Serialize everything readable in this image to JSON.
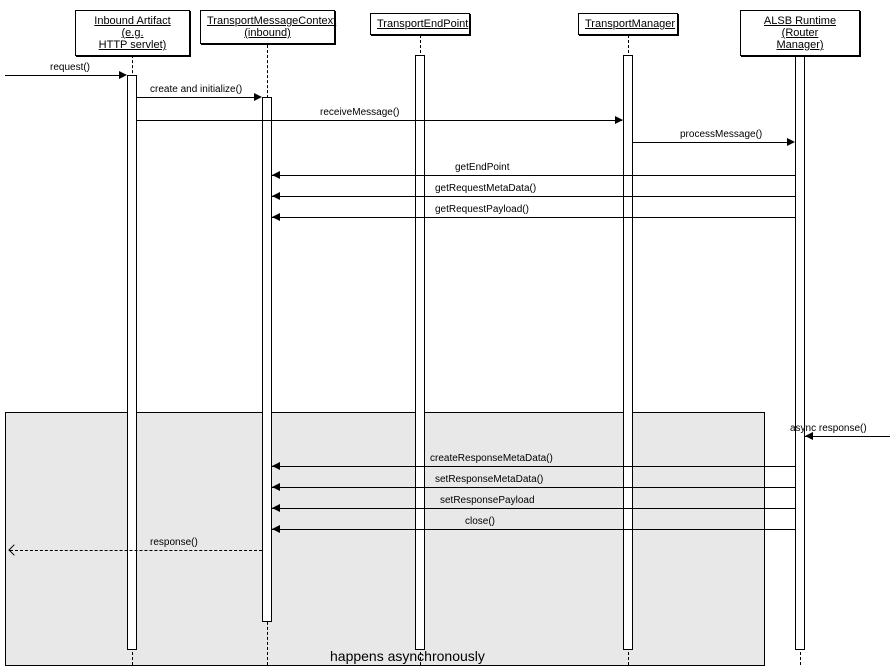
{
  "chart_data": {
    "type": "sequence",
    "participants": [
      {
        "id": "p1",
        "name": "Inbound Artifact (e.g. HTTP servlet)"
      },
      {
        "id": "p2",
        "name": "TransportMessageContext (inbound)"
      },
      {
        "id": "p3",
        "name": "TransportEndPoint"
      },
      {
        "id": "p4",
        "name": "TransportManager"
      },
      {
        "id": "p5",
        "name": "ALSB Runtime (Router Manager)"
      }
    ],
    "messages": [
      {
        "from": "ext",
        "to": "p1",
        "label": "request()"
      },
      {
        "from": "p1",
        "to": "p2",
        "label": "create and initialize()"
      },
      {
        "from": "p1",
        "to": "p4",
        "label": "receiveMessage()"
      },
      {
        "from": "p4",
        "to": "p5",
        "label": "processMessage()"
      },
      {
        "from": "p5",
        "to": "p2",
        "label": "getEndPoint"
      },
      {
        "from": "p5",
        "to": "p2",
        "label": "getRequestMetaData()"
      },
      {
        "from": "p5",
        "to": "p2",
        "label": "getRequestPayload()"
      },
      {
        "from": "ext",
        "to": "p5",
        "label": "async response()"
      },
      {
        "from": "p5",
        "to": "p2",
        "label": "createResponseMetaData()"
      },
      {
        "from": "p5",
        "to": "p2",
        "label": "setResponseMetaData()"
      },
      {
        "from": "p5",
        "to": "p2",
        "label": "setResponsePayload"
      },
      {
        "from": "p5",
        "to": "p2",
        "label": "close()"
      },
      {
        "from": "p2",
        "to": "ext",
        "label": "response()",
        "dashed": true
      }
    ],
    "region_label": "happens asynchronously"
  },
  "labels": {
    "p1": "Inbound Artifact (e.g.\nHTTP servlet)",
    "p2": "TransportMessageContext\n(inbound)",
    "p3": "TransportEndPoint",
    "p4": "TransportManager",
    "p5": "ALSB Runtime (Router\nManager)",
    "m_request": "request()",
    "m_create": "create and initialize()",
    "m_receive": "receiveMessage()",
    "m_process": "processMessage()",
    "m_getendpoint": "getEndPoint",
    "m_getreqmeta": "getRequestMetaData()",
    "m_getreqpayload": "getRequestPayload()",
    "m_async": "async response()",
    "m_createresp": "createResponseMetaData()",
    "m_setrespmd": "setResponseMetaData()",
    "m_setresppl": "setResponsePayload",
    "m_close": "close()",
    "m_response": "response()",
    "region": "happens asynchronously"
  }
}
